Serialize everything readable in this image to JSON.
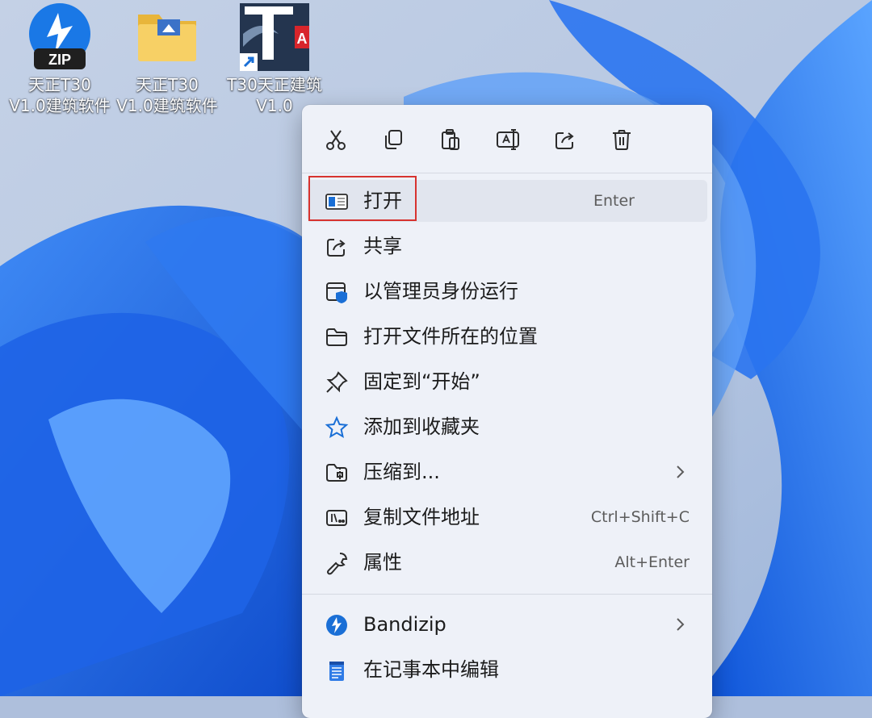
{
  "desktop": {
    "icons": [
      {
        "label": "天正T30\nV1.0建筑软件",
        "icon": "zip-archive-icon"
      },
      {
        "label": "天正T30\nV1.0建筑软件",
        "icon": "folder-icon"
      },
      {
        "label": "T30天正建筑\nV1.0",
        "icon": "tarch-app-shortcut-icon",
        "badge_text": "A"
      }
    ]
  },
  "toolbar": [
    {
      "name": "cut",
      "icon": "scissors-icon"
    },
    {
      "name": "copy",
      "icon": "copy-icon"
    },
    {
      "name": "paste",
      "icon": "clipboard-icon"
    },
    {
      "name": "rename",
      "icon": "rename-icon"
    },
    {
      "name": "share",
      "icon": "share-icon"
    },
    {
      "name": "delete",
      "icon": "trash-icon"
    }
  ],
  "menu": {
    "items": [
      {
        "label": "打开",
        "shortcut": "Enter",
        "icon": "window-open-icon"
      },
      {
        "label": "共享",
        "icon": "share-icon"
      },
      {
        "label": "以管理员身份运行",
        "icon": "admin-shield-icon"
      },
      {
        "label": "打开文件所在的位置",
        "icon": "folder-outline-icon"
      },
      {
        "label": "固定到“开始”",
        "icon": "pin-icon"
      },
      {
        "label": "添加到收藏夹",
        "icon": "star-icon"
      },
      {
        "label": "压缩到...",
        "icon": "zip-folder-icon",
        "submenu": true
      },
      {
        "label": "复制文件地址",
        "shortcut": "Ctrl+Shift+C",
        "icon": "path-icon"
      },
      {
        "label": "属性",
        "shortcut": "Alt+Enter",
        "icon": "wrench-icon"
      }
    ],
    "extra_items": [
      {
        "label": "Bandizip",
        "icon": "bandizip-icon",
        "submenu": true
      },
      {
        "label": "在记事本中编辑",
        "icon": "notepad-icon"
      }
    ]
  },
  "colors": {
    "accent": "#0b63d0",
    "highlight_border": "#d7332f",
    "menu_bg": "#eef1f8"
  }
}
